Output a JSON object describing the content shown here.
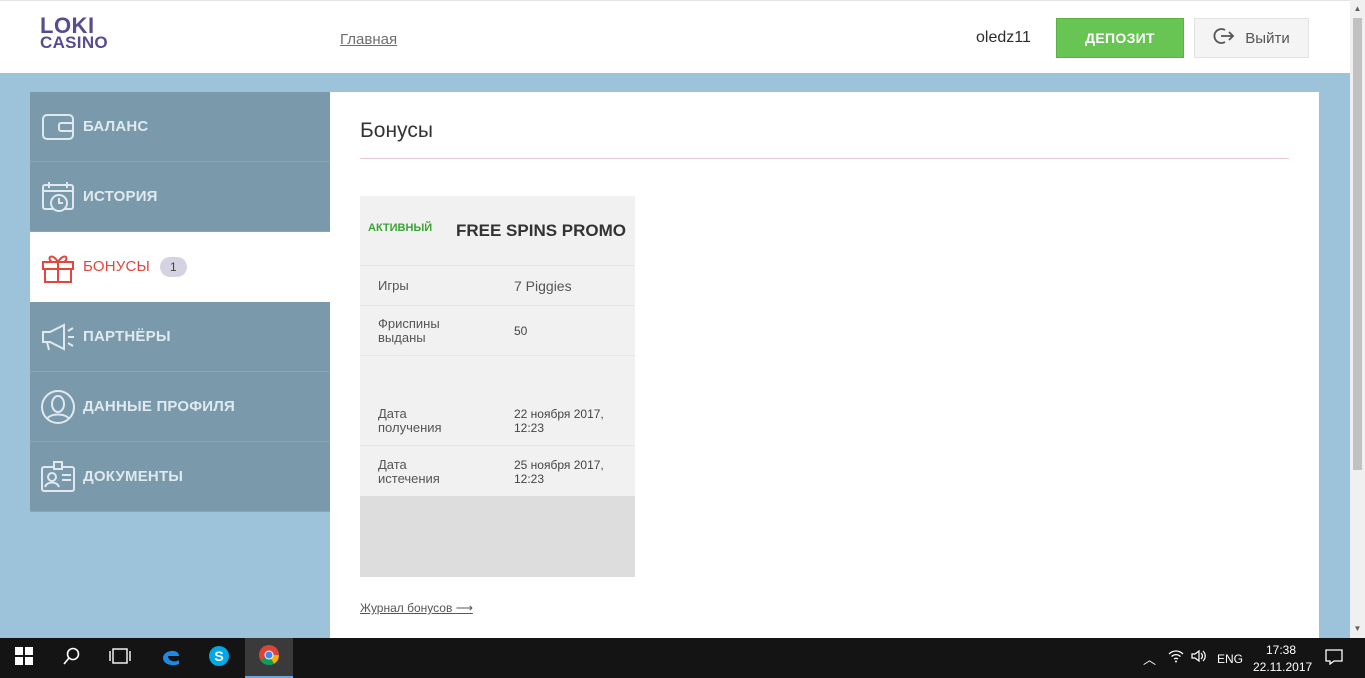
{
  "header": {
    "logo_line1": "LOKI",
    "logo_line2": "CASINO",
    "nav_home": "Главная",
    "username": "oledz11",
    "deposit_label": "ДЕПОЗИТ",
    "logout_label": "Выйти"
  },
  "sidebar": {
    "items": [
      {
        "label": "БАЛАНС",
        "icon": "wallet-icon"
      },
      {
        "label": "ИСТОРИЯ",
        "icon": "calendar-clock-icon"
      },
      {
        "label": "БОНУСЫ",
        "icon": "gift-icon",
        "badge": "1",
        "active": true
      },
      {
        "label": "ПАРТНЁРЫ",
        "icon": "megaphone-icon"
      },
      {
        "label": "ДАННЫЕ ПРОФИЛЯ",
        "icon": "user-circle-icon"
      },
      {
        "label": "ДОКУМЕНТЫ",
        "icon": "id-card-icon"
      }
    ]
  },
  "main": {
    "title": "Бонусы",
    "bonus_card": {
      "status": "АКТИВНЫЙ",
      "name": "FREE SPINS PROMO",
      "rows": [
        {
          "key": "Игры",
          "value": "7 Piggies"
        },
        {
          "key": "Фриспины выданы",
          "value": "50"
        },
        {
          "key": "Дата получения",
          "value": "22 ноября 2017, 12:23"
        },
        {
          "key": "Дата истечения",
          "value": "25 ноября 2017, 12:23"
        }
      ]
    },
    "journal_link": "Журнал бонусов"
  },
  "taskbar": {
    "language": "ENG",
    "time": "17:38",
    "date": "22.11.2017"
  },
  "colors": {
    "accent_green": "#68c553",
    "active_red": "#e2463c",
    "sidebar_bg": "#7a9aab",
    "page_bg": "#9cc3da",
    "status_green": "#3aa533"
  }
}
